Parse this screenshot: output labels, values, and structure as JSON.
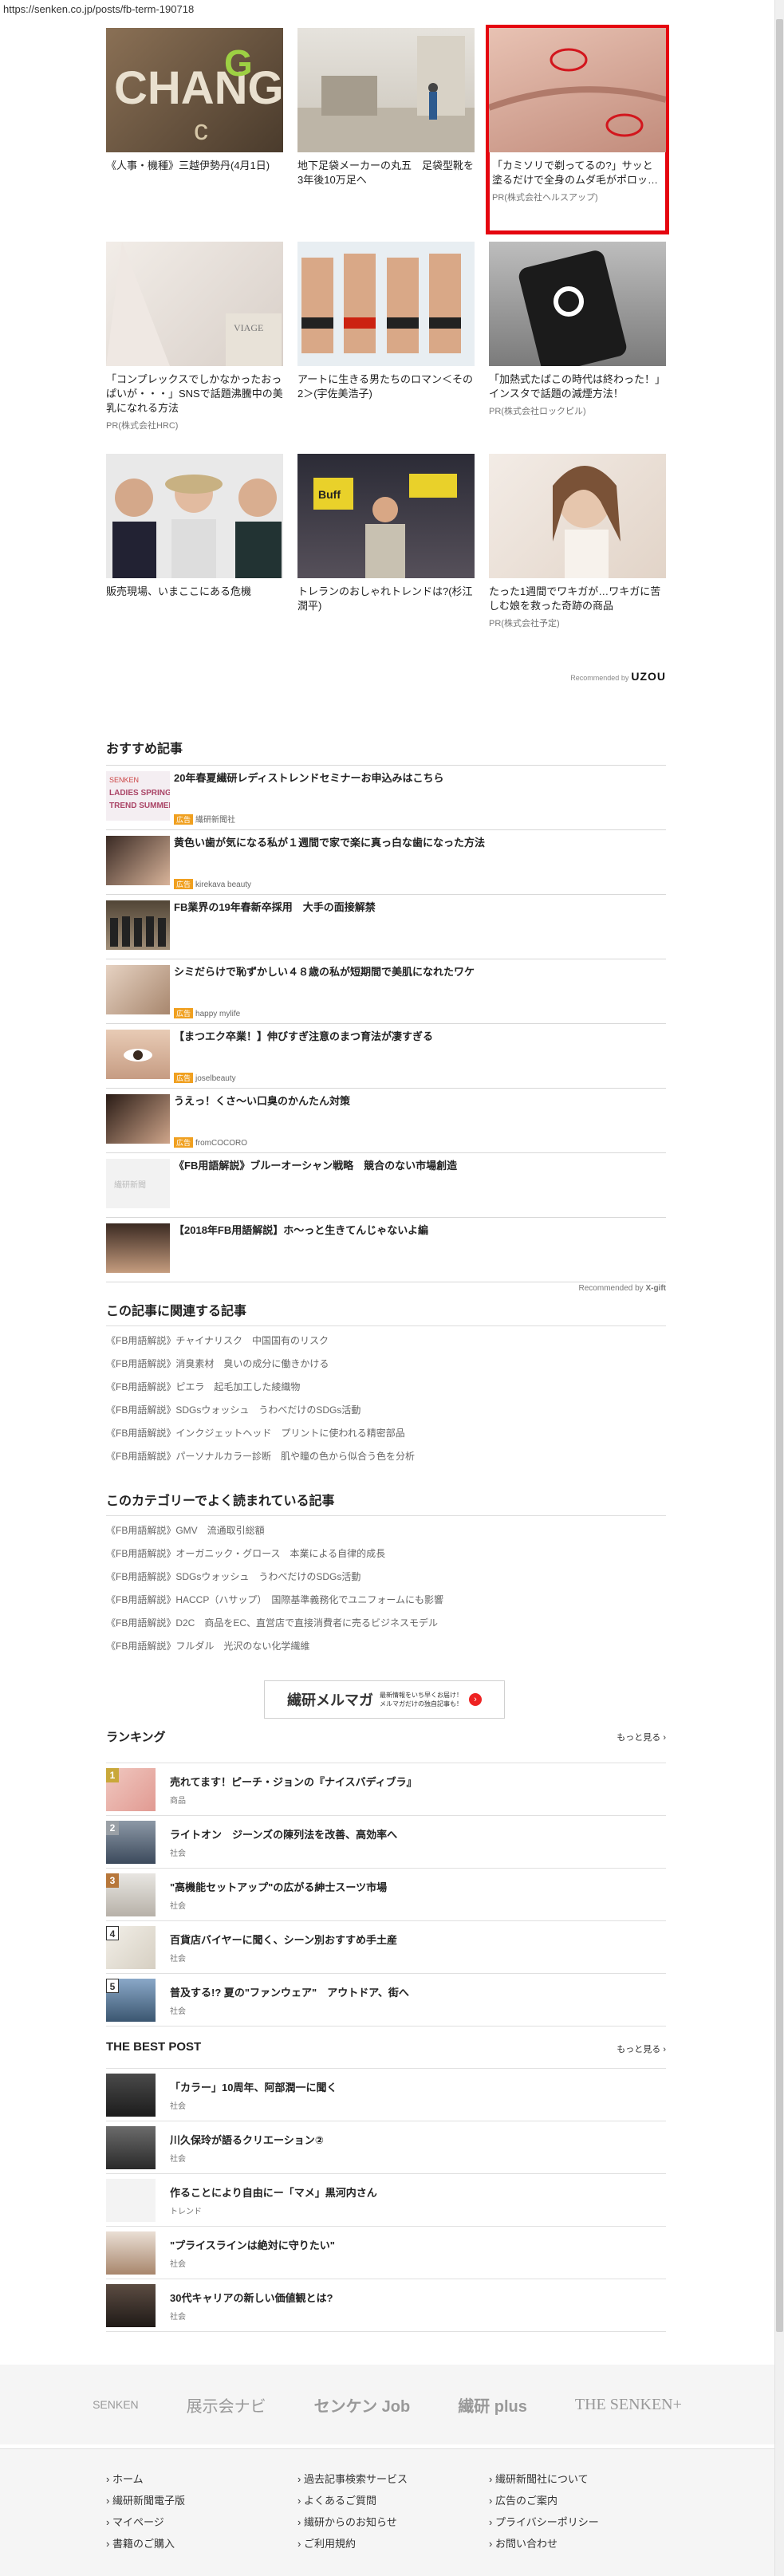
{
  "url": "https://senken.co.jp/posts/fb-term-190718",
  "recommended_grid": [
    {
      "title": "《人事・機種》三越伊勢丹(4月1日)",
      "pr": ""
    },
    {
      "title": "地下足袋メーカーの丸五　足袋型靴を3年後10万足へ",
      "pr": ""
    },
    {
      "title": "「カミソリで剃ってるの?」サッと塗るだけで全身のムダ毛がポロッ…",
      "pr": "PR(株式会社ヘルスアップ)"
    },
    {
      "title": "「コンプレックスでしかなかったおっぱいが・・・」SNSで話題沸騰中の美乳になれる方法",
      "pr": "PR(株式会社HRC)"
    },
    {
      "title": "アートに生きる男たちのロマン＜その2＞(宇佐美浩子)",
      "pr": ""
    },
    {
      "title": "「加熱式たばこの時代は終わった！」インスタで話題の減煙方法！",
      "pr": "PR(株式会社ロックピル)"
    },
    {
      "title": "販売現場、いまここにある危機",
      "pr": ""
    },
    {
      "title": "トレランのおしゃれトレンドは?(杉江潤平)",
      "pr": ""
    },
    {
      "title": "たった1週間でワキガが…ワキガに苦しむ娘を救った奇跡の商品",
      "pr": "PR(株式会社予定)"
    }
  ],
  "recommended_by": "Recommended by",
  "uzou": "UZOU",
  "osusume": {
    "heading": "おすすめ記事",
    "items": [
      {
        "title": "20年春夏繊研レディストレンドセミナーお申込みはこちら",
        "src": "繊研新聞社",
        "ad": "広告"
      },
      {
        "title": "黄色い歯が気になる私が１週間で家で楽に真っ白な歯になった方法",
        "src": "kirekava beauty",
        "ad": "広告"
      },
      {
        "title": "FB業界の19年春新卒採用　大手の面接解禁",
        "src": "",
        "ad": ""
      },
      {
        "title": "シミだらけで恥ずかしい４８歳の私が短期間で美肌になれたワケ",
        "src": "happy mylife",
        "ad": "広告"
      },
      {
        "title": "【まつエク卒業！】伸びすぎ注意のまつ育法が凄すぎる",
        "src": "joselbeauty",
        "ad": "広告"
      },
      {
        "title": "うえっ！くさ〜い口臭のかんたん対策",
        "src": "fromCOCORO",
        "ad": "広告"
      },
      {
        "title": "《FB用語解説》ブルーオーシャン戦略　競合のない市場創造",
        "src": "",
        "ad": ""
      },
      {
        "title": "【2018年FB用語解説】ホ〜っと生きてんじゃないよ編",
        "src": "",
        "ad": ""
      }
    ],
    "recommended_by": "Recommended by",
    "xgift": "X-gift"
  },
  "related": {
    "heading": "この記事に関連する記事",
    "items": [
      "《FB用語解説》チャイナリスク　中国国有のリスク",
      "《FB用語解説》消臭素材　臭いの成分に働きかける",
      "《FB用語解説》ピエラ　起毛加工した綾織物",
      "《FB用語解説》SDGsウォッシュ　うわべだけのSDGs活動",
      "《FB用語解説》インクジェットヘッド　プリントに使われる精密部品",
      "《FB用語解説》パーソナルカラー診断　肌や瞳の色から似合う色を分析"
    ]
  },
  "popular": {
    "heading": "このカテゴリーでよく読まれている記事",
    "items": [
      "《FB用語解説》GMV　流通取引総額",
      "《FB用語解説》オーガニック・グロース　本業による自律的成長",
      "《FB用語解説》SDGsウォッシュ　うわべだけのSDGs活動",
      "《FB用語解説》HACCP（ハサップ）　国際基準義務化でユニフォームにも影響",
      "《FB用語解説》D2C　商品をEC、直営店で直接消費者に売るビジネスモデル",
      "《FB用語解説》フルダル　光沢のない化学繊維"
    ]
  },
  "mail_banner": {
    "title": "繊研メルマガ",
    "text": "最新情報をいち早くお届け！\nメルマガだけの独自記事も！",
    "icon": "arrow-right-icon"
  },
  "ranking": {
    "heading": "ランキング",
    "more": "もっと見る",
    "items": [
      {
        "num": "1",
        "title": "売れてます！ピーチ・ジョンの『ナイスバディブラ』",
        "src": "商品"
      },
      {
        "num": "2",
        "title": "ライトオン　ジーンズの陳列法を改善、高効率へ",
        "src": "社会"
      },
      {
        "num": "3",
        "title": "\"高機能セットアップ\"の広がる紳士スーツ市場",
        "src": "社会"
      },
      {
        "num": "4",
        "title": "百貨店バイヤーに聞く、シーン別おすすめ手土産",
        "src": "社会"
      },
      {
        "num": "5",
        "title": "普及する!? 夏の\"ファンウェア\"　アウトドア、街へ",
        "src": "社会"
      }
    ]
  },
  "best_post": {
    "heading": "THE BEST POST",
    "more": "もっと見る",
    "items": [
      {
        "title": "「カラー」10周年、阿部潤一に聞く",
        "src": "社会"
      },
      {
        "title": "川久保玲が語るクリエーション②",
        "src": "社会"
      },
      {
        "title": "作ることにより自由にー「マメ」黒河内さん",
        "src": "トレンド"
      },
      {
        "title": "\"プライスラインは絶対に守りたい\"",
        "src": "社会"
      },
      {
        "title": "30代キャリアの新しい価値観とは?",
        "src": "社会"
      }
    ]
  },
  "footer_logos": [
    "SENKEN",
    "展示会ナビ",
    "センケン Job",
    "繊研 plus",
    "THE SENKEN+"
  ],
  "footer_links": {
    "col1": [
      "ホーム",
      "繊研新聞電子版",
      "マイページ",
      "書籍のご購入"
    ],
    "col2": [
      "過去記事検索サービス",
      "よくあるご質問",
      "繊研からのお知らせ",
      "ご利用規約"
    ],
    "col3": [
      "繊研新聞社について",
      "広告のご案内",
      "プライバシーポリシー",
      "お問い合わせ"
    ]
  }
}
